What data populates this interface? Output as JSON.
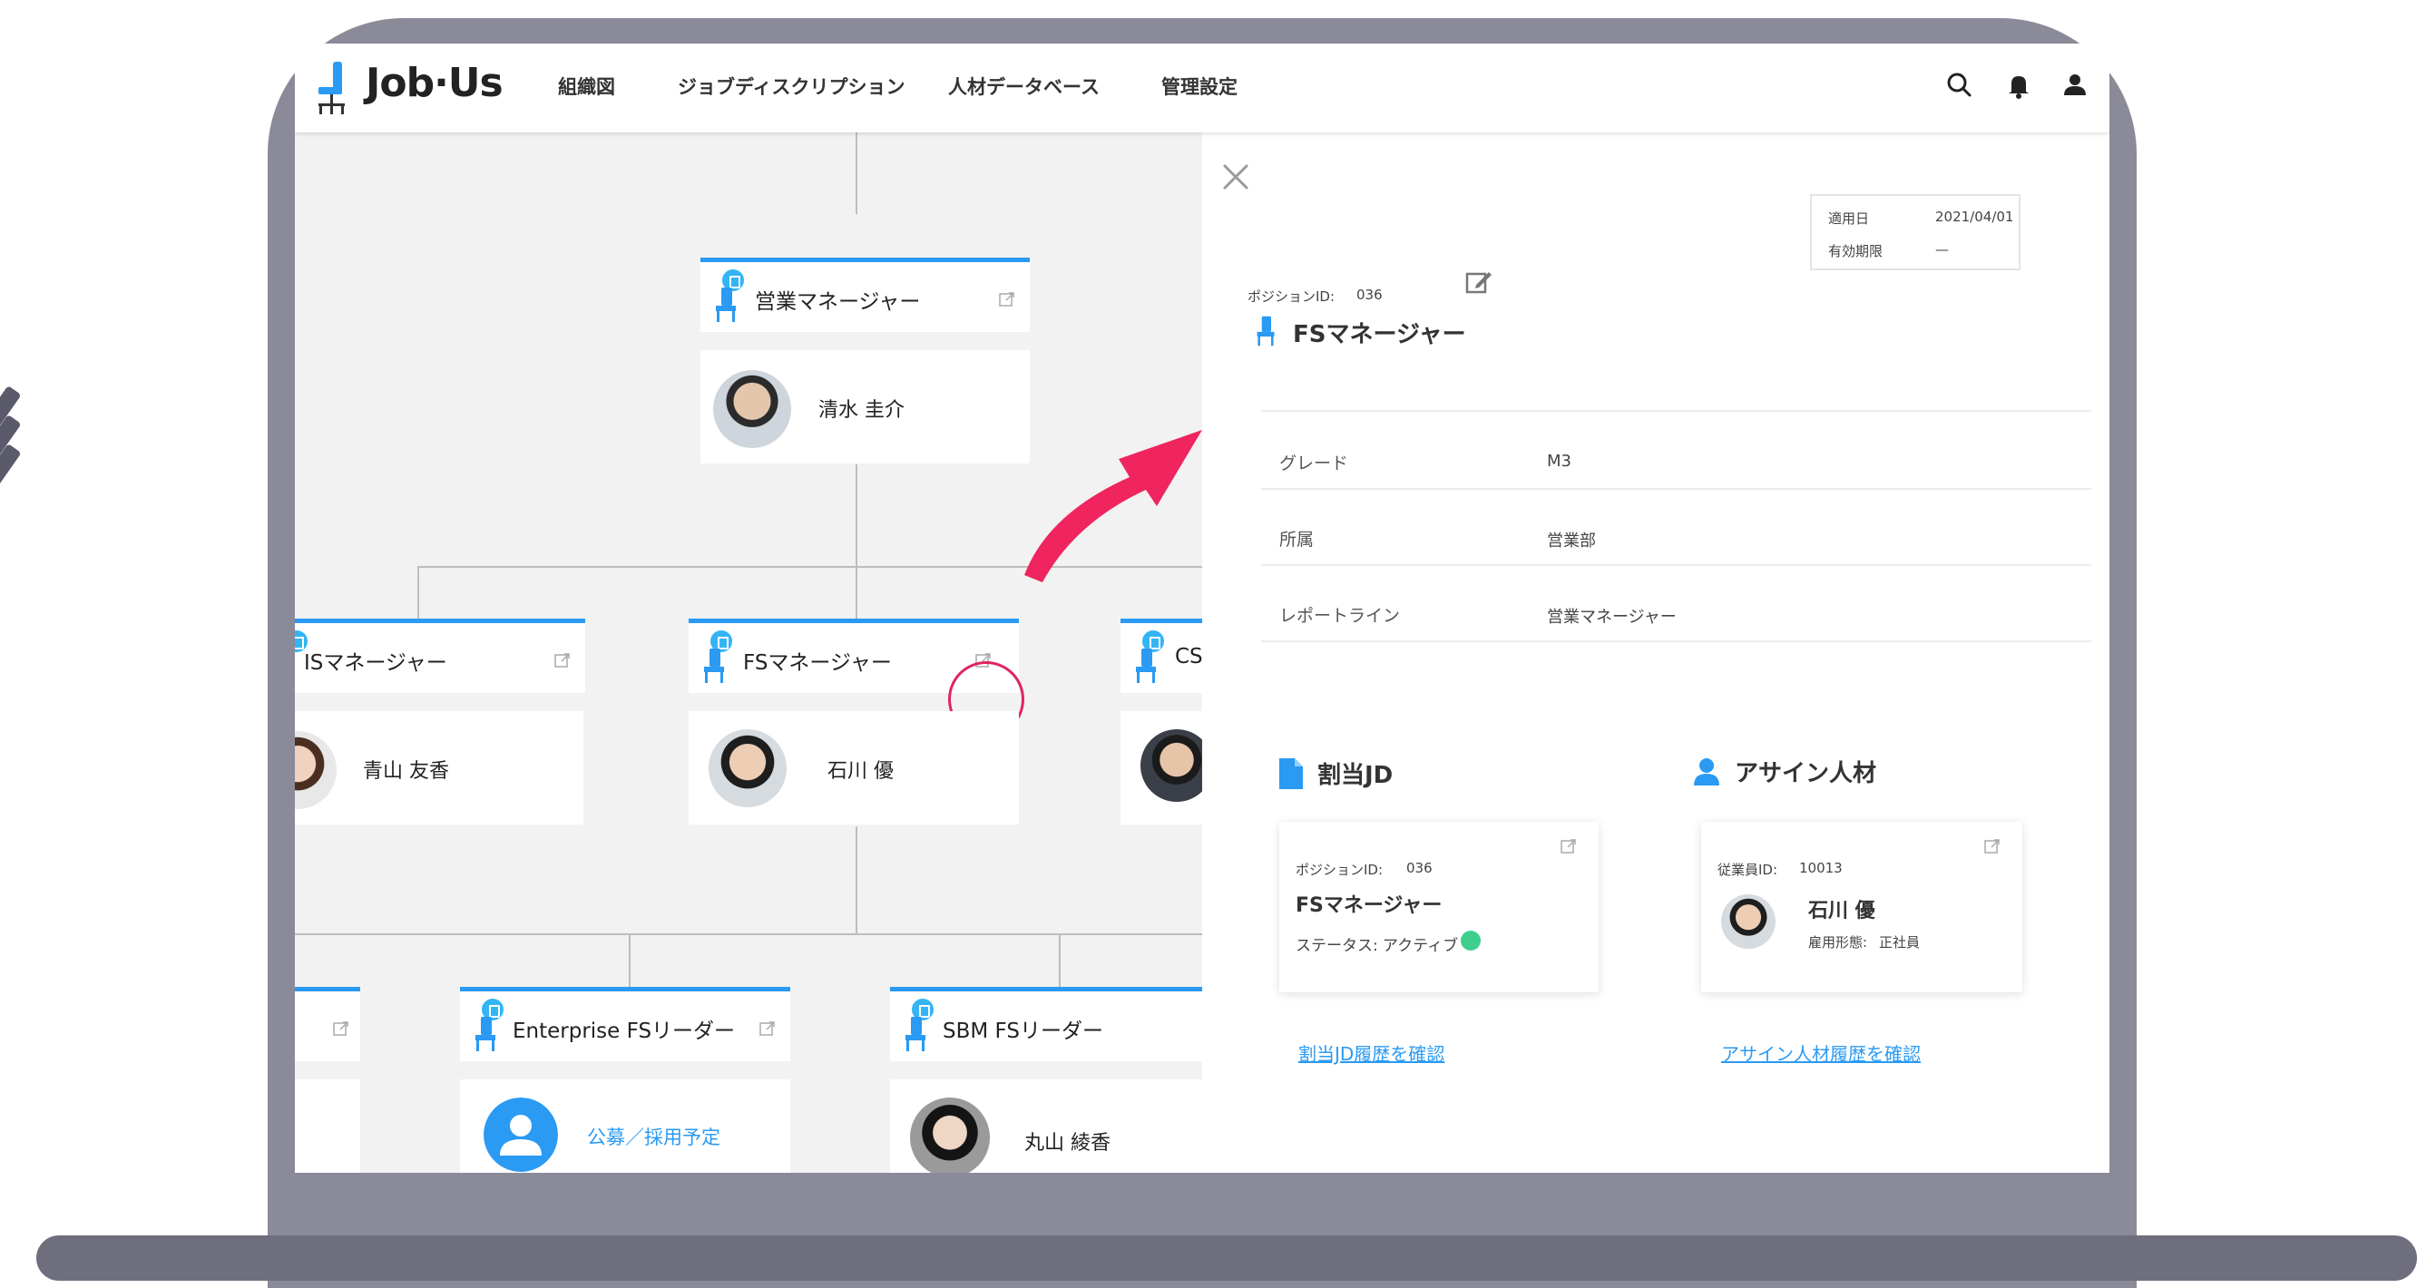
{
  "app": {
    "logo": "Job·Us",
    "nav": [
      "組織図",
      "ジョブディスクリプション",
      "人材データベース",
      "管理設定"
    ]
  },
  "org": {
    "manager": {
      "position": "営業マネージャー",
      "person": "清水 圭介"
    },
    "mid": [
      {
        "position": "ISマネージャー",
        "person": "青山 友香"
      },
      {
        "position": "FSマネージャー",
        "person": "石川 優"
      },
      {
        "position": "CS"
      }
    ],
    "lower": [
      {
        "position": "Enterprise FSリーダー",
        "vacancy": "公募／採用予定"
      },
      {
        "position": "SBM FSリーダー",
        "person": "丸山 綾香"
      }
    ]
  },
  "panel": {
    "position_id_label": "ポジションID:",
    "position_id": "036",
    "title": "FSマネージャー",
    "dates": {
      "effective_label": "適用日",
      "effective": "2021/04/01",
      "expiry_label": "有効期限",
      "expiry": "—"
    },
    "fields": [
      {
        "label": "グレード",
        "value": "M3"
      },
      {
        "label": "所属",
        "value": "営業部"
      },
      {
        "label": "レポートライン",
        "value": "営業マネージャー"
      }
    ],
    "jd": {
      "heading": "割当JD",
      "id_label": "ポジションID:",
      "id": "036",
      "title": "FSマネージャー",
      "status_label": "ステータス:",
      "status": "アクティブ",
      "status_color": "#3ecf8e",
      "history_link": "割当JD履歴を確認"
    },
    "assignee": {
      "heading": "アサイン人材",
      "id_label": "従業員ID:",
      "id": "10013",
      "name": "石川 優",
      "employment_label": "雇用形態:",
      "employment": "正社員",
      "history_link": "アサイン人材履歴を確認"
    }
  },
  "colors": {
    "accent": "#2a9af3",
    "highlight": "#e0245e",
    "frame": "#8b8a99"
  }
}
